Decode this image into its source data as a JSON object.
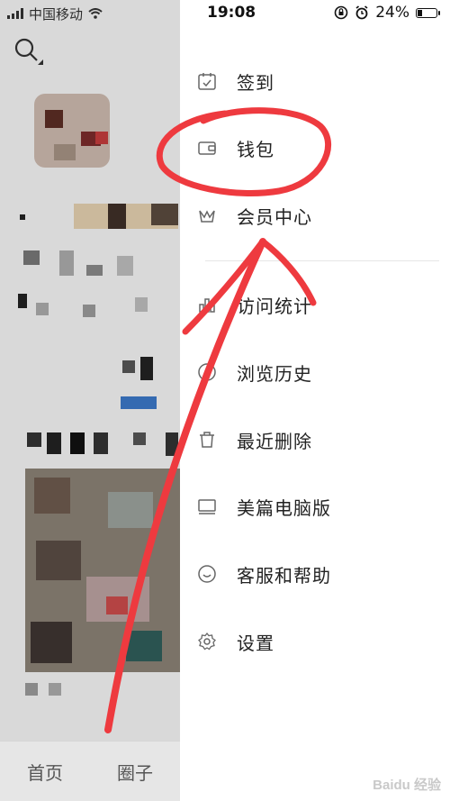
{
  "background_app": {
    "status_bar": {
      "carrier": "中国移动"
    },
    "tabbar": {
      "home": "首页",
      "circle": "圈子"
    }
  },
  "drawer": {
    "status_bar": {
      "time": "19:08",
      "battery": "24%"
    },
    "items": [
      {
        "label": "签到",
        "icon": "calendar-check-icon"
      },
      {
        "label": "钱包",
        "icon": "wallet-icon"
      },
      {
        "label": "会员中心",
        "icon": "vip-crown-icon"
      },
      {
        "label": "访问统计",
        "icon": "bar-chart-icon"
      },
      {
        "label": "浏览历史",
        "icon": "clock-icon"
      },
      {
        "label": "最近删除",
        "icon": "trash-icon"
      },
      {
        "label": "美篇电脑版",
        "icon": "monitor-icon"
      },
      {
        "label": "客服和帮助",
        "icon": "chat-support-icon"
      },
      {
        "label": "设置",
        "icon": "gear-icon"
      }
    ]
  },
  "annotation": {
    "color": "#ee3a3f"
  },
  "watermark": "Baidu 经验"
}
